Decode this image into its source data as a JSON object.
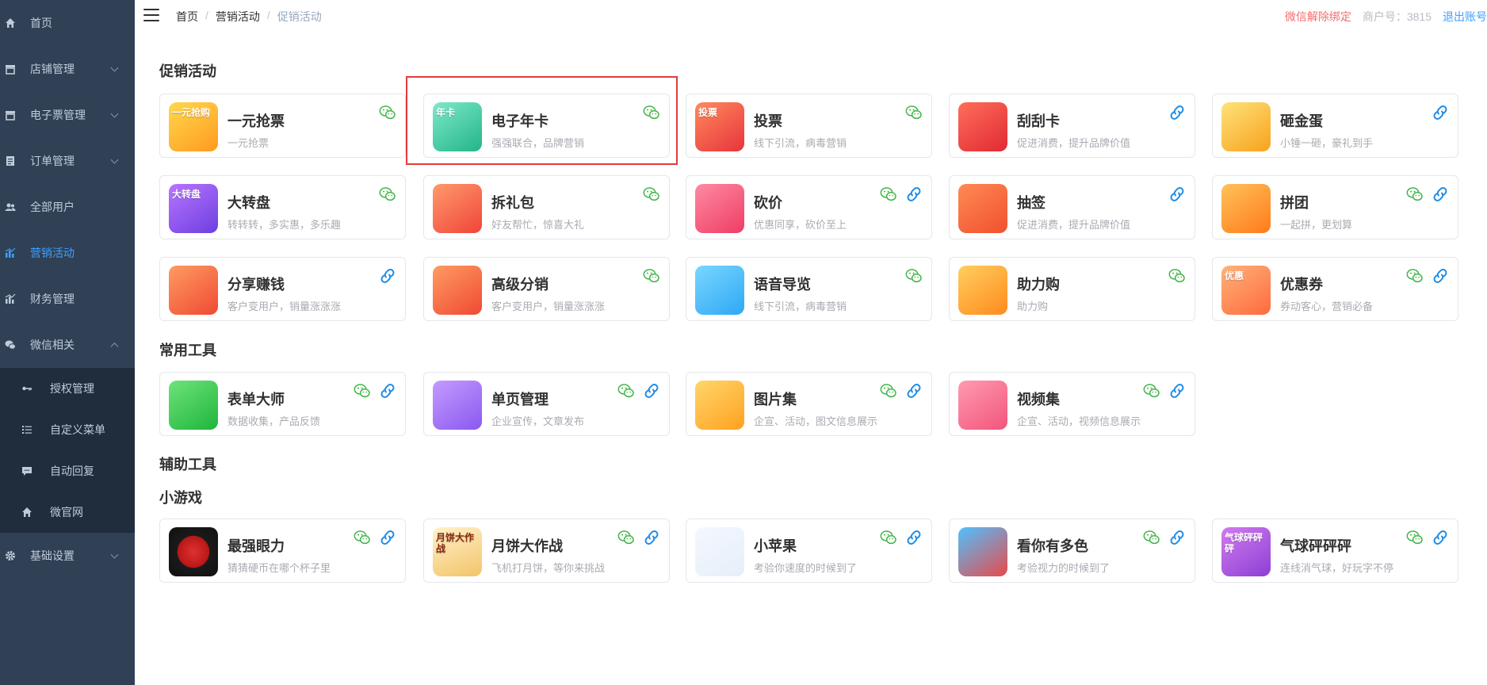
{
  "sidebar": {
    "items": [
      {
        "label": "首页",
        "icon": "home-icon"
      },
      {
        "label": "店铺管理",
        "icon": "store-icon"
      },
      {
        "label": "电子票管理",
        "icon": "ticket-icon"
      },
      {
        "label": "订单管理",
        "icon": "order-icon"
      },
      {
        "label": "全部用户",
        "icon": "users-icon"
      },
      {
        "label": "营销活动",
        "icon": "chart-icon"
      },
      {
        "label": "财务管理",
        "icon": "finance-icon"
      },
      {
        "label": "微信相关",
        "icon": "wechat-icon"
      },
      {
        "label": "授权管理",
        "icon": "key-icon"
      },
      {
        "label": "自定义菜单",
        "icon": "list-icon"
      },
      {
        "label": "自动回复",
        "icon": "chat-icon"
      },
      {
        "label": "微官网",
        "icon": "home-icon"
      },
      {
        "label": "基础设置",
        "icon": "gear-icon"
      }
    ]
  },
  "header": {
    "breadcrumb": [
      "首页",
      "营销活动",
      "促销活动"
    ],
    "separator": "/",
    "unbind": "微信解除绑定",
    "merchant": "商户号：3815",
    "logout": "退出账号"
  },
  "sections": {
    "promo": "促销活动",
    "tools": "常用工具",
    "aux": "辅助工具",
    "games": "小游戏"
  },
  "cards": [
    {
      "name": "一元抢票",
      "desc": "一元抢票",
      "badges": [
        "wechat"
      ],
      "thumb": "yiyuan-thumb",
      "thumb_text": "一元抢购"
    },
    {
      "name": "电子年卡",
      "desc": "强强联合，品牌营销",
      "badges": [
        "wechat"
      ],
      "thumb": "nianka-thumb",
      "thumb_text": "年卡"
    },
    {
      "name": "投票",
      "desc": "线下引流，病毒营销",
      "badges": [
        "wechat"
      ],
      "thumb": "toupiao-thumb",
      "thumb_text": "投票"
    },
    {
      "name": "刮刮卡",
      "desc": "促进消费，提升品牌价值",
      "badges": [
        "link"
      ],
      "thumb": "guaguaka-thumb",
      "thumb_text": ""
    },
    {
      "name": "砸金蛋",
      "desc": "小锤一砸，豪礼到手",
      "badges": [
        "link"
      ],
      "thumb": "zajindan-thumb",
      "thumb_text": ""
    },
    {
      "name": "大转盘",
      "desc": "转转转，多实惠，多乐趣",
      "badges": [
        "wechat"
      ],
      "thumb": "dazhuanpan-thumb",
      "thumb_text": "大转盘"
    },
    {
      "name": "拆礼包",
      "desc": "好友帮忙，惊喜大礼",
      "badges": [
        "wechat"
      ],
      "thumb": "chailibao-thumb",
      "thumb_text": ""
    },
    {
      "name": "砍价",
      "desc": "优惠同享，砍价至上",
      "badges": [
        "wechat",
        "link"
      ],
      "thumb": "kanjia-thumb",
      "thumb_text": ""
    },
    {
      "name": "抽签",
      "desc": "促进消费，提升品牌价值",
      "badges": [
        "link"
      ],
      "thumb": "chouqian-thumb",
      "thumb_text": ""
    },
    {
      "name": "拼团",
      "desc": "一起拼，更划算",
      "badges": [
        "wechat",
        "link"
      ],
      "thumb": "pintuan-thumb",
      "thumb_text": ""
    },
    {
      "name": "分享赚钱",
      "desc": "客户变用户，销量涨涨涨",
      "badges": [
        "link"
      ],
      "thumb": "fenxiang-thumb",
      "thumb_text": ""
    },
    {
      "name": "高级分销",
      "desc": "客户变用户，销量涨涨涨",
      "badges": [
        "wechat"
      ],
      "thumb": "fenxiao-thumb",
      "thumb_text": ""
    },
    {
      "name": "语音导览",
      "desc": "线下引流，病毒营销",
      "badges": [
        "wechat"
      ],
      "thumb": "yuyin-thumb",
      "thumb_text": ""
    },
    {
      "name": "助力购",
      "desc": "助力购",
      "badges": [
        "wechat"
      ],
      "thumb": "zhuli-thumb",
      "thumb_text": ""
    },
    {
      "name": "优惠券",
      "desc": "券动客心，营销必备",
      "badges": [
        "wechat",
        "link"
      ],
      "thumb": "youhuiquan-thumb",
      "thumb_text": "优惠"
    },
    {
      "name": "表单大师",
      "desc": "数据收集，产品反馈",
      "badges": [
        "wechat",
        "link"
      ],
      "thumb": "biaodan-thumb",
      "thumb_text": ""
    },
    {
      "name": "单页管理",
      "desc": "企业宣传，文章发布",
      "badges": [
        "wechat",
        "link"
      ],
      "thumb": "danye-thumb",
      "thumb_text": ""
    },
    {
      "name": "图片集",
      "desc": "企宣、活动，图文信息展示",
      "badges": [
        "wechat",
        "link"
      ],
      "thumb": "tupian-thumb",
      "thumb_text": ""
    },
    {
      "name": "视频集",
      "desc": "企宣、活动，视频信息展示",
      "badges": [
        "wechat",
        "link"
      ],
      "thumb": "shipin-thumb",
      "thumb_text": ""
    },
    {
      "name": "最强眼力",
      "desc": "猜猜硬币在哪个杯子里",
      "badges": [
        "wechat",
        "link"
      ],
      "thumb": "yanli-thumb",
      "thumb_text": ""
    },
    {
      "name": "月饼大作战",
      "desc": "飞机打月饼，等你来挑战",
      "badges": [
        "wechat",
        "link"
      ],
      "thumb": "yuebing-thumb",
      "thumb_text": "月饼大作战"
    },
    {
      "name": "小苹果",
      "desc": "考验你速度的时候到了",
      "badges": [
        "wechat",
        "link"
      ],
      "thumb": "pingguo-thumb",
      "thumb_text": ""
    },
    {
      "name": "看你有多色",
      "desc": "考验视力的时候到了",
      "badges": [
        "wechat",
        "link"
      ],
      "thumb": "duose-thumb",
      "thumb_text": ""
    },
    {
      "name": "气球砰砰砰",
      "desc": "连线消气球，好玩字不停",
      "badges": [
        "wechat",
        "link"
      ],
      "thumb": "qiqiu-thumb",
      "thumb_text": "气球砰砰砰"
    }
  ],
  "colors": {
    "sidebar_bg": "#304156",
    "submenu_bg": "#1f2d3d",
    "accent": "#409eff",
    "wechat": "#43b649",
    "link": "#1e8ce6",
    "highlight": "#e23b3b"
  }
}
